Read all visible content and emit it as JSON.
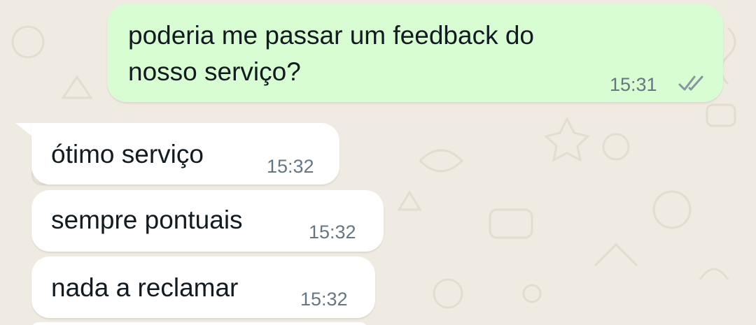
{
  "chat": {
    "messages": [
      {
        "direction": "outgoing",
        "text_line1": "poderia me passar um feedback do",
        "text_line2": "nosso serviço?",
        "time": "15:31",
        "status": "delivered",
        "status_icon": "double-check-icon"
      },
      {
        "direction": "incoming",
        "text": "ótimo serviço",
        "time": "15:32"
      },
      {
        "direction": "incoming",
        "text": "sempre pontuais",
        "time": "15:32"
      },
      {
        "direction": "incoming",
        "text": "nada a reclamar",
        "time": "15:32"
      }
    ]
  },
  "colors": {
    "wallpaper": "#efeae2",
    "outgoing_bubble": "#d9fdd3",
    "incoming_bubble": "#ffffff",
    "timestamp": "#667781",
    "ticks": "#8696a0"
  }
}
